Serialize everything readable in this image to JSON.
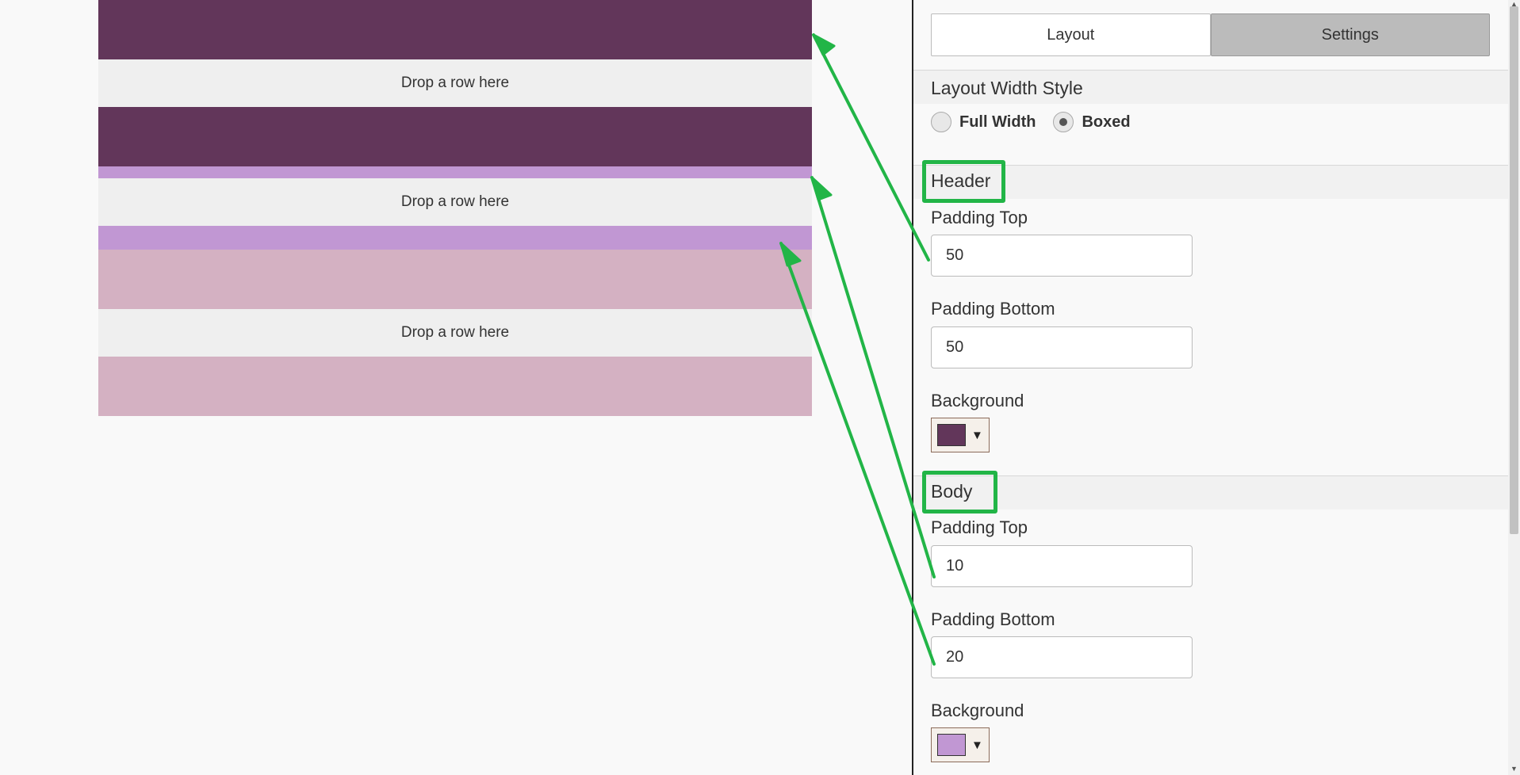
{
  "preview": {
    "drop_label": "Drop a row here",
    "colors": {
      "header": "#62365a",
      "body": "#c197d3",
      "footer": "#d4b1c2",
      "drop_zone": "#efefef"
    }
  },
  "tabs": {
    "layout_label": "Layout",
    "settings_label": "Settings",
    "active": "settings"
  },
  "layout_width": {
    "title": "Layout Width Style",
    "options": [
      "Full Width",
      "Boxed"
    ],
    "selected": "Boxed"
  },
  "header": {
    "title": "Header",
    "padding_top_label": "Padding Top",
    "padding_top_value": "50",
    "padding_bottom_label": "Padding Bottom",
    "padding_bottom_value": "50",
    "background_label": "Background",
    "background_color": "#62365a"
  },
  "body_section": {
    "title": "Body",
    "padding_top_label": "Padding Top",
    "padding_top_value": "10",
    "padding_bottom_label": "Padding Bottom",
    "padding_bottom_value": "20",
    "background_label": "Background",
    "background_color": "#c197d3"
  },
  "annotation": {
    "color": "#22b547"
  },
  "icons": {
    "dropdown": "caret-down-icon",
    "scroll_up": "scroll-up-arrow-icon",
    "scroll_down": "scroll-down-arrow-icon"
  }
}
